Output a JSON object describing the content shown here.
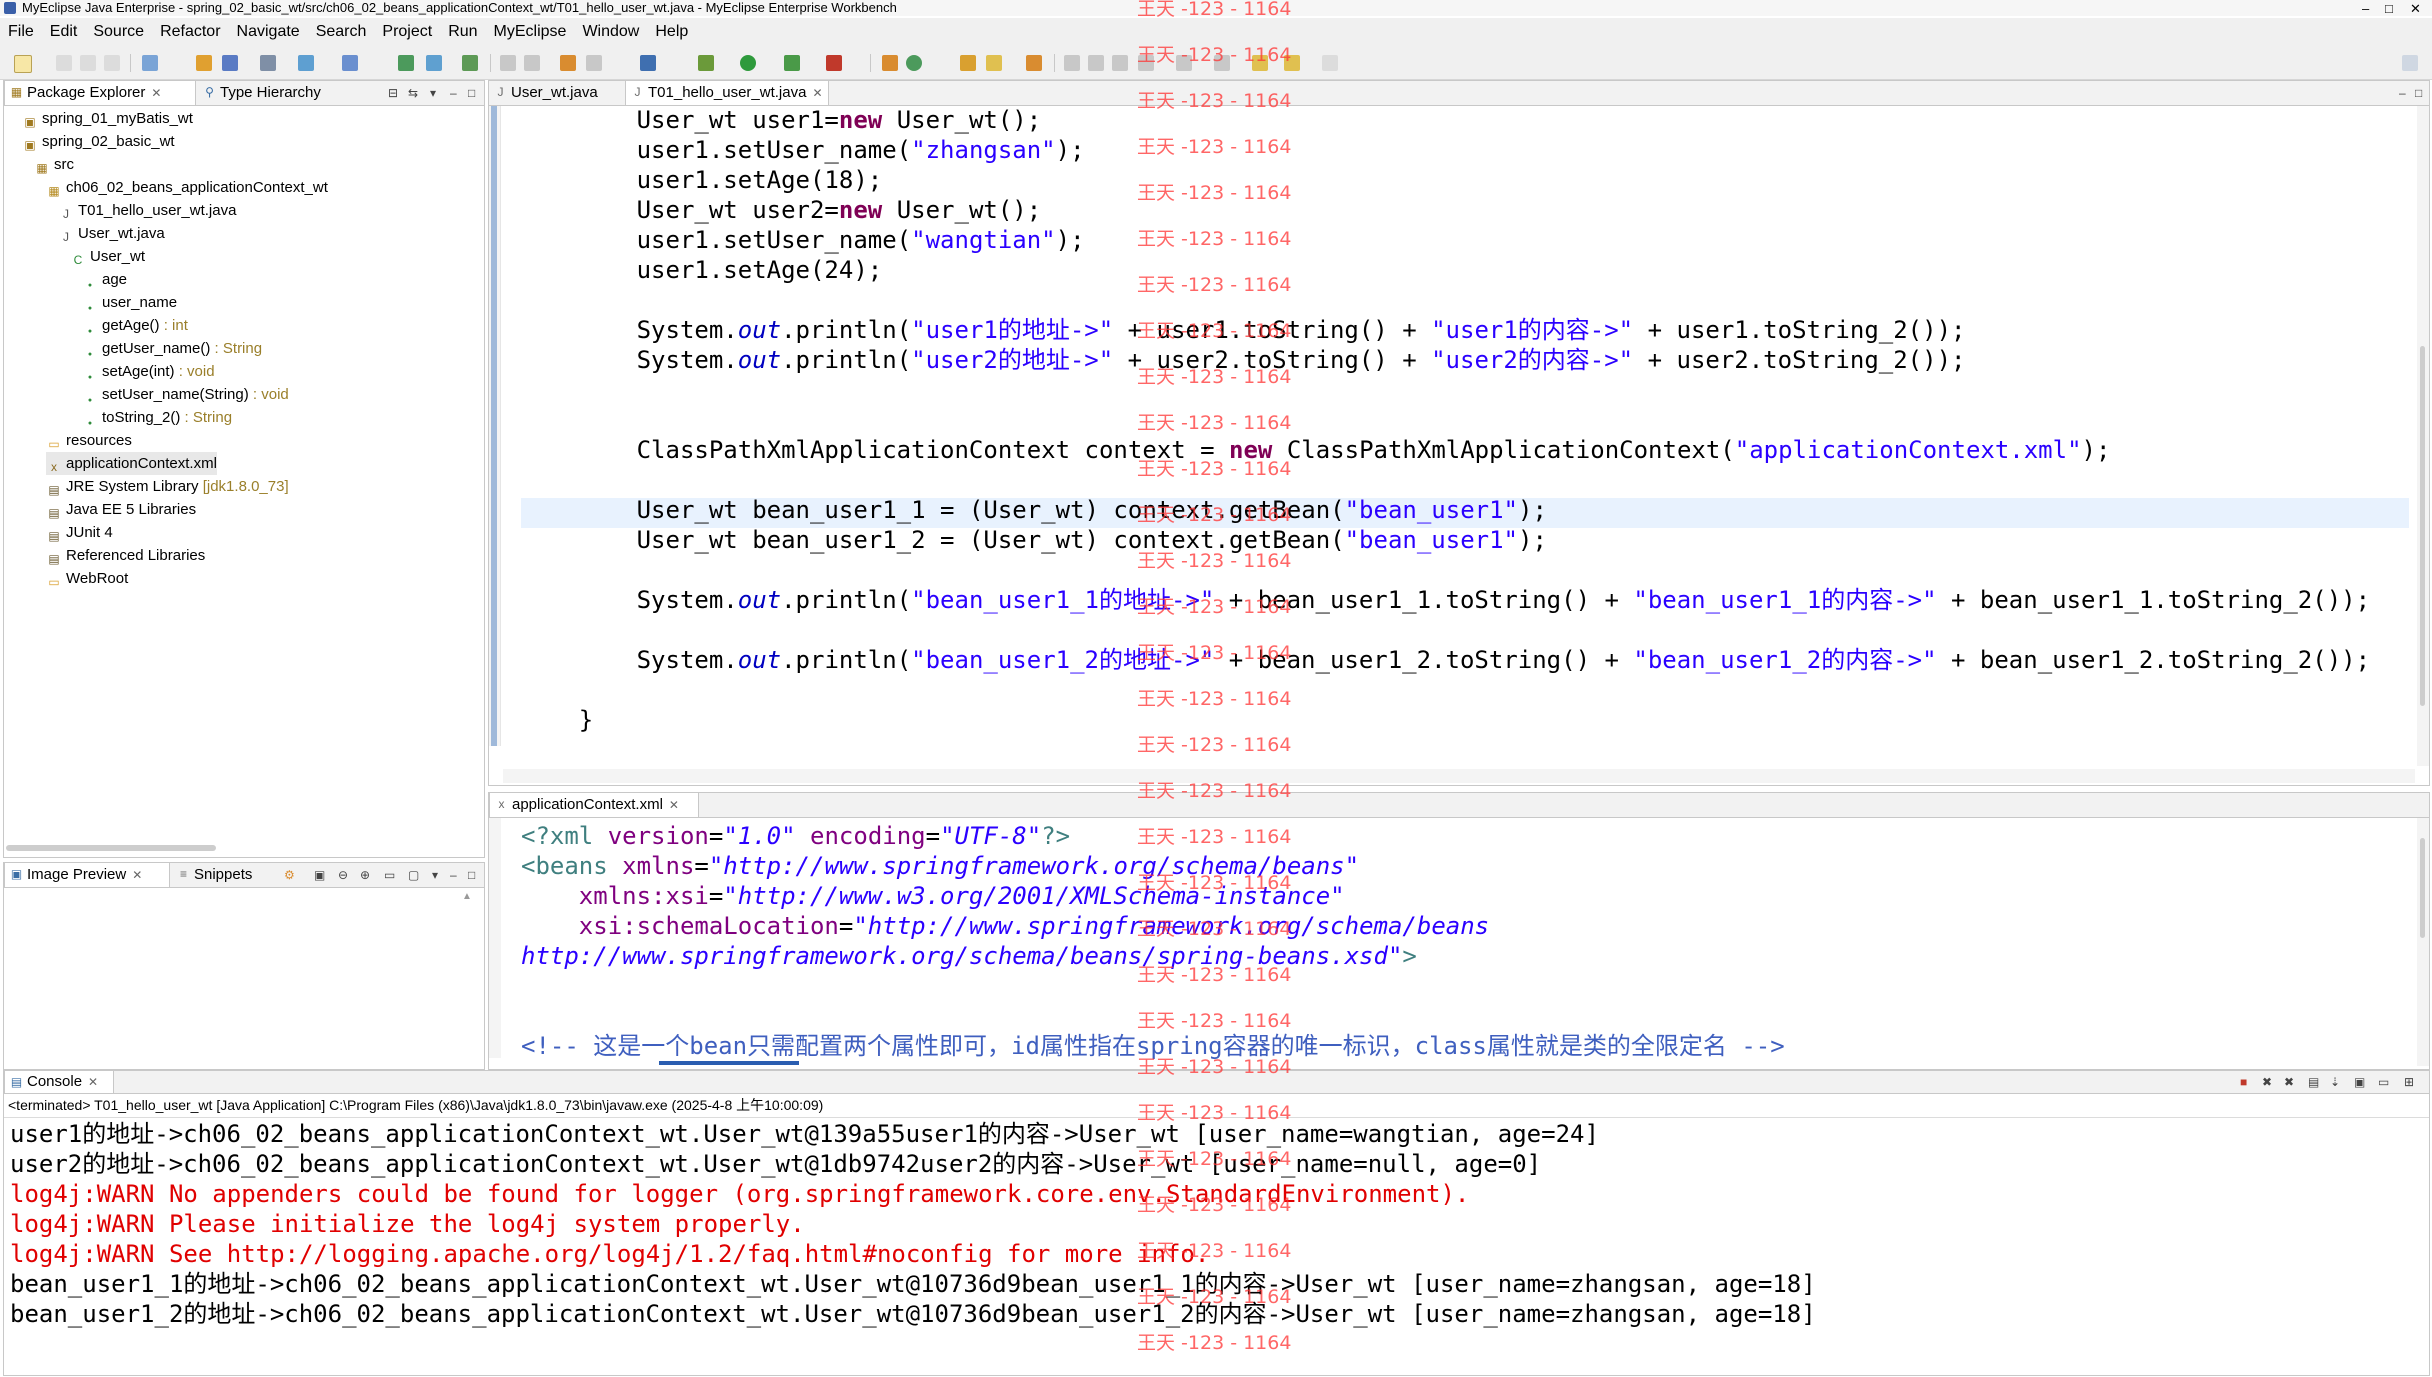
{
  "window": {
    "title": "MyEclipse Java Enterprise - spring_02_basic_wt/src/ch06_02_beans_applicationContext_wt/T01_hello_user_wt.java - MyEclipse Enterprise Workbench"
  },
  "menu": [
    "File",
    "Edit",
    "Source",
    "Refactor",
    "Navigate",
    "Search",
    "Project",
    "Run",
    "MyEclipse",
    "Window",
    "Help"
  ],
  "explorer": {
    "tabs": [
      "Package Explorer",
      "Type Hierarchy"
    ],
    "tree": [
      {
        "label": "spring_01_myBatis_wt",
        "icon": "project-icon",
        "detail": ""
      },
      {
        "label": "spring_02_basic_wt",
        "icon": "project-icon",
        "detail": ""
      },
      {
        "label": "src",
        "icon": "source-folder-icon",
        "detail": ""
      },
      {
        "label": "ch06_02_beans_applicationContext_wt",
        "icon": "package-icon",
        "detail": ""
      },
      {
        "label": "T01_hello_user_wt.java",
        "icon": "java-file-icon",
        "detail": ""
      },
      {
        "label": "User_wt.java",
        "icon": "java-file-icon",
        "detail": ""
      },
      {
        "label": "User_wt",
        "icon": "class-icon",
        "detail": ""
      },
      {
        "label": "age",
        "icon": "field-icon",
        "detail": ""
      },
      {
        "label": "user_name",
        "icon": "field-icon",
        "detail": ""
      },
      {
        "label": "getAge()",
        "icon": "method-icon",
        "detail": " : int"
      },
      {
        "label": "getUser_name()",
        "icon": "method-icon",
        "detail": " : String"
      },
      {
        "label": "setAge(int)",
        "icon": "method-icon",
        "detail": " : void"
      },
      {
        "label": "setUser_name(String)",
        "icon": "method-icon",
        "detail": " : void"
      },
      {
        "label": "toString_2()",
        "icon": "method-icon",
        "detail": " : String"
      },
      {
        "label": "resources",
        "icon": "folder-icon",
        "detail": ""
      },
      {
        "label": "applicationContext.xml",
        "icon": "xml-file-icon",
        "detail": ""
      },
      {
        "label": "JRE System Library",
        "icon": "library-icon",
        "detail": " [jdk1.8.0_73]"
      },
      {
        "label": "Java EE 5 Libraries",
        "icon": "library-icon",
        "detail": ""
      },
      {
        "label": "JUnit 4",
        "icon": "library-icon",
        "detail": ""
      },
      {
        "label": "Referenced Libraries",
        "icon": "library-icon",
        "detail": ""
      },
      {
        "label": "WebRoot",
        "icon": "folder-icon",
        "detail": ""
      }
    ]
  },
  "preview": {
    "tabs": [
      "Image Preview",
      "Snippets"
    ]
  },
  "editor": {
    "tabs": [
      "User_wt.java",
      "T01_hello_user_wt.java"
    ],
    "lines": [
      [
        [
          "",
          "        User_wt user1="
        ],
        [
          "kw",
          "new"
        ],
        [
          "",
          " User_wt();"
        ]
      ],
      [
        [
          "",
          "        user1.setUser_name("
        ],
        [
          "str",
          "\"zhangsan\""
        ],
        [
          "",
          ");"
        ]
      ],
      [
        [
          "",
          "        user1.setAge(18);"
        ]
      ],
      [
        [
          "",
          "        User_wt user2="
        ],
        [
          "kw",
          "new"
        ],
        [
          "",
          " User_wt();"
        ]
      ],
      [
        [
          "",
          "        user1.setUser_name("
        ],
        [
          "str",
          "\"wangtian\""
        ],
        [
          "",
          ");"
        ]
      ],
      [
        [
          "",
          "        user1.setAge(24);"
        ]
      ],
      [
        [
          "",
          ""
        ]
      ],
      [
        [
          "",
          "        System."
        ],
        [
          "fld",
          "out"
        ],
        [
          "",
          ".println("
        ],
        [
          "str",
          "\"user1的地址->\""
        ],
        [
          "",
          " + user1.toString() + "
        ],
        [
          "str",
          "\"user1的内容->\""
        ],
        [
          "",
          " + user1.toString_2());"
        ]
      ],
      [
        [
          "",
          "        System."
        ],
        [
          "fld",
          "out"
        ],
        [
          "",
          ".println("
        ],
        [
          "str",
          "\"user2的地址->\""
        ],
        [
          "",
          " + user2.toString() + "
        ],
        [
          "str",
          "\"user2的内容->\""
        ],
        [
          "",
          " + user2.toString_2());"
        ]
      ],
      [
        [
          "",
          ""
        ]
      ],
      [
        [
          "",
          ""
        ]
      ],
      [
        [
          "",
          "        ClassPathXmlApplicationContext context = "
        ],
        [
          "kw",
          "new"
        ],
        [
          "",
          " ClassPathXmlApplicationContext("
        ],
        [
          "str",
          "\"applicationContext.xml\""
        ],
        [
          "",
          ");"
        ]
      ],
      [
        [
          "",
          ""
        ]
      ],
      [
        [
          "",
          "        User_wt bean_user1_1 = (User_wt) context.getBean("
        ],
        [
          "str",
          "\"bean_user1\""
        ],
        [
          "",
          ");"
        ]
      ],
      [
        [
          "",
          "        User_wt bean_user1_2 = (User_wt) context.getBean("
        ],
        [
          "str",
          "\"bean_user1\""
        ],
        [
          "",
          ");"
        ]
      ],
      [
        [
          "",
          ""
        ]
      ],
      [
        [
          "",
          "        System."
        ],
        [
          "fld",
          "out"
        ],
        [
          "",
          ".println("
        ],
        [
          "str",
          "\"bean_user1_1的地址->\""
        ],
        [
          "",
          " + bean_user1_1.toString() + "
        ],
        [
          "str",
          "\"bean_user1_1的内容->\""
        ],
        [
          "",
          " + bean_user1_1.toString_2());"
        ]
      ],
      [
        [
          "",
          ""
        ]
      ],
      [
        [
          "",
          "        System."
        ],
        [
          "fld",
          "out"
        ],
        [
          "",
          ".println("
        ],
        [
          "str",
          "\"bean_user1_2的地址->\""
        ],
        [
          "",
          " + bean_user1_2.toString() + "
        ],
        [
          "str",
          "\"bean_user1_2的内容->\""
        ],
        [
          "",
          " + bean_user1_2.toString_2());"
        ]
      ],
      [
        [
          "",
          ""
        ]
      ],
      [
        [
          "",
          "    }"
        ]
      ]
    ]
  },
  "xml_editor": {
    "tab": "applicationContext.xml",
    "lines": [
      [
        [
          "tag",
          "<?xml "
        ],
        [
          "attr",
          "version"
        ],
        [
          "",
          "="
        ],
        [
          "val",
          "\"1.0\""
        ],
        [
          "",
          " "
        ],
        [
          "attr",
          "encoding"
        ],
        [
          "",
          "="
        ],
        [
          "val",
          "\"UTF-8\""
        ],
        [
          "tag",
          "?>"
        ]
      ],
      [
        [
          "tag",
          "<beans "
        ],
        [
          "attr",
          "xmlns"
        ],
        [
          "",
          "="
        ],
        [
          "val",
          "\"http://www.springframework.org/schema/beans\""
        ]
      ],
      [
        [
          "",
          "    "
        ],
        [
          "attr",
          "xmlns:xsi"
        ],
        [
          "",
          "="
        ],
        [
          "val",
          "\"http://www.w3.org/2001/XMLSchema-instance\""
        ]
      ],
      [
        [
          "",
          "    "
        ],
        [
          "attr",
          "xsi:schemaLocation"
        ],
        [
          "",
          "="
        ],
        [
          "val",
          "\"http://www.springframework.org/schema/beans"
        ]
      ],
      [
        [
          "val",
          "http://www.springframework.org/schema/beans/spring-beans.xsd\""
        ],
        [
          "tag",
          ">"
        ]
      ],
      [
        [
          "",
          ""
        ]
      ],
      [
        [
          "",
          ""
        ]
      ],
      [
        [
          "cmt",
          "<!-- 这是一个bean只需配置两个属性即可，id属性指在spring容器的唯一标识，class属性就是类的全限定名 -->"
        ]
      ]
    ]
  },
  "console": {
    "tab": "Console",
    "status": "<terminated> T01_hello_user_wt [Java Application] C:\\Program Files (x86)\\Java\\jdk1.8.0_73\\bin\\javaw.exe (2025-4-8 上午10:00:09)",
    "lines": [
      {
        "t": "out",
        "text": "user1的地址->ch06_02_beans_applicationContext_wt.User_wt@139a55user1的内容->User_wt [user_name=wangtian, age=24]"
      },
      {
        "t": "out",
        "text": "user2的地址->ch06_02_beans_applicationContext_wt.User_wt@1db9742user2的内容->User_wt [user_name=null, age=0]"
      },
      {
        "t": "err",
        "text": "log4j:WARN No appenders could be found for logger (org.springframework.core.env.StandardEnvironment)."
      },
      {
        "t": "err",
        "text": "log4j:WARN Please initialize the log4j system properly."
      },
      {
        "t": "err",
        "text": "log4j:WARN See http://logging.apache.org/log4j/1.2/faq.html#noconfig for more info."
      },
      {
        "t": "out",
        "text": "bean_user1_1的地址->ch06_02_beans_applicationContext_wt.User_wt@10736d9bean_user1_1的内容->User_wt [user_name=zhangsan, age=18]"
      },
      {
        "t": "out",
        "text": "bean_user1_2的地址->ch06_02_beans_applicationContext_wt.User_wt@10736d9bean_user1_2的内容->User_wt [user_name=zhangsan, age=18]"
      }
    ]
  },
  "watermark": {
    "text": "王天 -123 - 1164",
    "count": 30
  },
  "colors": {
    "keyword": "#7f0055",
    "string": "#2a00ff",
    "error": "#e00000",
    "watermark": "#ff3333"
  }
}
